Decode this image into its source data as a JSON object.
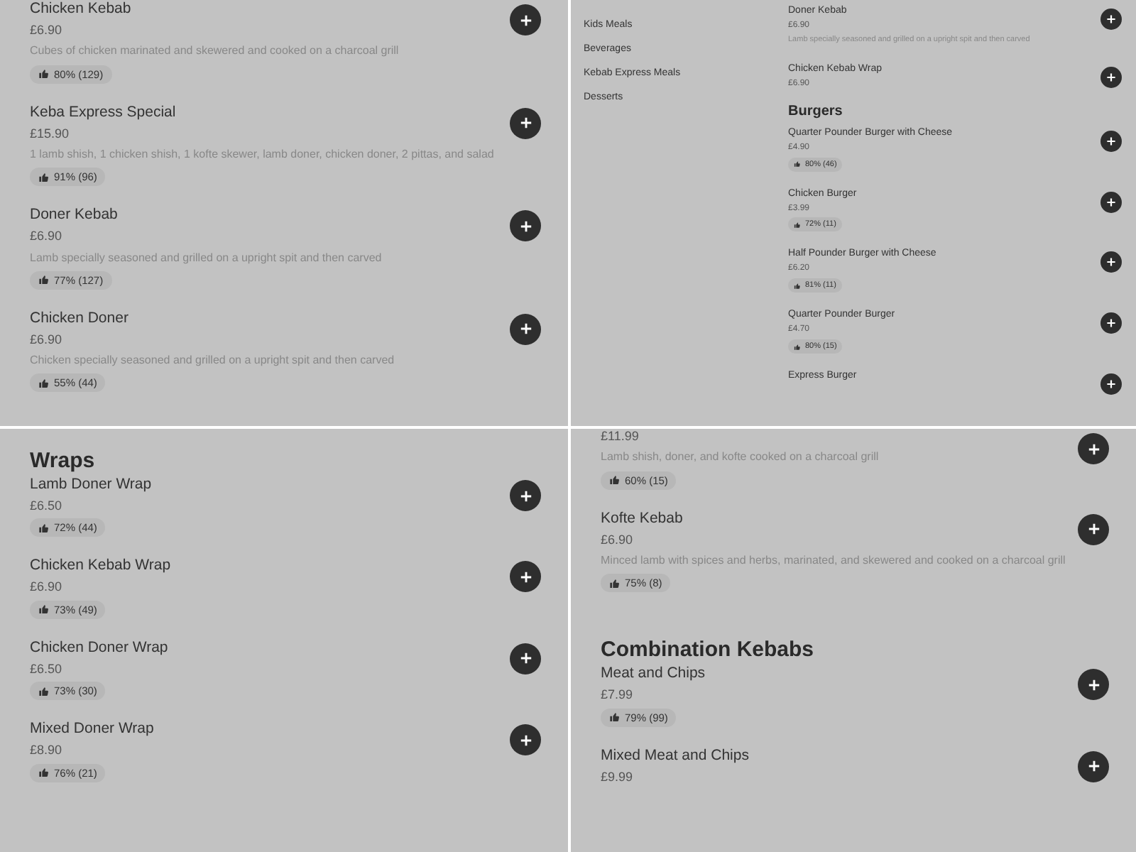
{
  "panels": [
    {
      "kind": "regular",
      "sections": [
        {
          "items": [
            {
              "name": "Chicken Kebab",
              "price": "£6.90",
              "description": "Cubes of chicken marinated and skewered and cooked on a charcoal grill",
              "rating": "80% (129)"
            },
            {
              "name": "Keba Express Special",
              "price": "£15.90",
              "description": "1 lamb shish, 1 chicken shish, 1 kofte skewer, lamb doner, chicken doner, 2 pittas, and salad",
              "rating": "91% (96)"
            },
            {
              "name": "Doner Kebab",
              "price": "£6.90",
              "description": "Lamb specially seasoned and grilled on a upright spit and then carved",
              "rating": "77% (127)"
            },
            {
              "name": "Chicken Doner",
              "price": "£6.90",
              "description": "Chicken specially seasoned and grilled on a upright spit and then carved",
              "rating": "55% (44)"
            }
          ]
        }
      ]
    },
    {
      "kind": "compact",
      "sidebar": [
        "Kids Meals",
        "Beverages",
        "Kebab Express Meals",
        "Desserts"
      ],
      "sections": [
        {
          "items": [
            {
              "name": "Doner Kebab",
              "price": "£6.90",
              "description": "Lamb specially seasoned and grilled on a upright spit and then carved"
            },
            {
              "name": "Chicken Kebab Wrap",
              "price": "£6.90"
            }
          ]
        },
        {
          "heading": "Burgers",
          "items": [
            {
              "name": "Quarter Pounder Burger with Cheese",
              "price": "£4.90",
              "rating": "80% (46)"
            },
            {
              "name": "Chicken Burger",
              "price": "£3.99",
              "rating": "72% (11)"
            },
            {
              "name": "Half Pounder Burger with Cheese",
              "price": "£6.20",
              "rating": "81% (11)"
            },
            {
              "name": "Quarter Pounder Burger",
              "price": "£4.70",
              "rating": "80% (15)"
            },
            {
              "name": "Express Burger"
            }
          ]
        }
      ]
    },
    {
      "kind": "regular",
      "sections": [
        {
          "heading": "Wraps",
          "items": [
            {
              "name": "Lamb Doner Wrap",
              "price": "£6.50",
              "rating": "72% (44)"
            },
            {
              "name": "Chicken Kebab Wrap",
              "price": "£6.90",
              "rating": "73% (49)"
            },
            {
              "name": "Chicken Doner Wrap",
              "price": "£6.50",
              "rating": "73% (30)"
            },
            {
              "name": "Mixed Doner Wrap",
              "price": "£8.90",
              "rating": "76% (21)"
            }
          ]
        }
      ]
    },
    {
      "kind": "regular",
      "sections": [
        {
          "items": [
            {
              "price": "£11.99",
              "description": "Lamb shish, doner, and kofte cooked on a charcoal grill",
              "rating": "60% (15)"
            },
            {
              "name": "Kofte Kebab",
              "price": "£6.90",
              "description": "Minced lamb with spices and herbs, marinated, and skewered and cooked on a charcoal grill",
              "rating": "75% (8)"
            }
          ]
        },
        {
          "heading": "Combination Kebabs",
          "items": [
            {
              "name": "Meat and Chips",
              "price": "£7.99",
              "rating": "79% (99)"
            },
            {
              "name": "Mixed Meat and Chips",
              "price": "£9.99"
            }
          ]
        }
      ]
    }
  ]
}
